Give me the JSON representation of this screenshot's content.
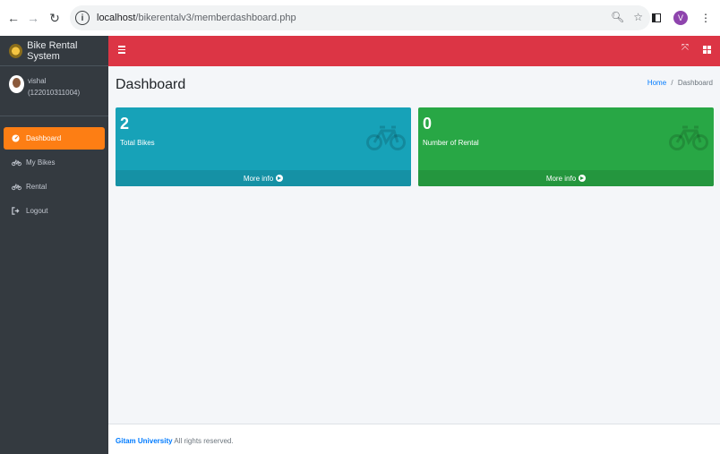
{
  "browser": {
    "url_host": "localhost",
    "url_path": "/bikerentalv3/memberdashboard.php",
    "profile_initial": "V"
  },
  "sidebar": {
    "brand": "Bike Rental System",
    "user_name": "vishal",
    "user_id": "(122010311004)",
    "items": [
      {
        "label": "Dashboard",
        "icon": "dashboard-icon",
        "active": true
      },
      {
        "label": "My Bikes",
        "icon": "bicycle-icon",
        "active": false
      },
      {
        "label": "Rental",
        "icon": "bicycle-icon",
        "active": false
      },
      {
        "label": "Logout",
        "icon": "logout-icon",
        "active": false
      }
    ]
  },
  "header": {
    "title": "Dashboard",
    "breadcrumb_home": "Home",
    "breadcrumb_sep": "/",
    "breadcrumb_current": "Dashboard"
  },
  "boxes": [
    {
      "value": "2",
      "label": "Total Bikes",
      "footer": "More info",
      "color": "#17a2b8"
    },
    {
      "value": "0",
      "label": "Number of Rental",
      "footer": "More info",
      "color": "#28a745"
    }
  ],
  "colors": {
    "navbar": "#dc3545",
    "sidebar": "#343a40",
    "active_item": "#fd7e14"
  },
  "footer": {
    "brand": "Gitam University",
    "text": " All rights reserved."
  }
}
